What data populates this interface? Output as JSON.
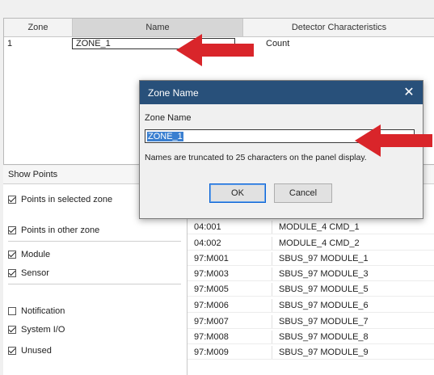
{
  "zone_grid": {
    "headers": {
      "zone": "Zone",
      "name": "Name",
      "detector": "Detector Characteristics"
    },
    "row": {
      "zone": "1",
      "name": "ZONE_1",
      "detector": "Count"
    }
  },
  "show_points": {
    "title": "Show Points",
    "items": [
      {
        "label": "Points in selected zone",
        "checked": true
      },
      {
        "label": "Points in other zone",
        "checked": true
      },
      {
        "label": "Module",
        "checked": true
      },
      {
        "label": "Sensor",
        "checked": true
      },
      {
        "label": "Notification",
        "checked": false
      },
      {
        "label": "System I/O",
        "checked": true
      },
      {
        "label": "Unused",
        "checked": true
      }
    ]
  },
  "points": [
    {
      "address": "04:001",
      "label": "MODULE_4 CMD_1"
    },
    {
      "address": "04:002",
      "label": "MODULE_4 CMD_2"
    },
    {
      "address": "97:M001",
      "label": "SBUS_97 MODULE_1"
    },
    {
      "address": "97:M003",
      "label": "SBUS_97 MODULE_3"
    },
    {
      "address": "97:M005",
      "label": "SBUS_97 MODULE_5"
    },
    {
      "address": "97:M006",
      "label": "SBUS_97 MODULE_6"
    },
    {
      "address": "97:M007",
      "label": "SBUS_97 MODULE_7"
    },
    {
      "address": "97:M008",
      "label": "SBUS_97 MODULE_8"
    },
    {
      "address": "97:M009",
      "label": "SBUS_97 MODULE_9"
    }
  ],
  "dialog": {
    "title": "Zone Name",
    "close_icon": "close-icon",
    "field_label": "Zone Name",
    "value": "ZONE_1",
    "note": "Names are truncated to 25 characters on the panel display.",
    "ok_label": "OK",
    "cancel_label": "Cancel"
  },
  "colors": {
    "title_bar": "#28507a",
    "selection": "#3a7fd0",
    "arrow": "#d9252a"
  }
}
